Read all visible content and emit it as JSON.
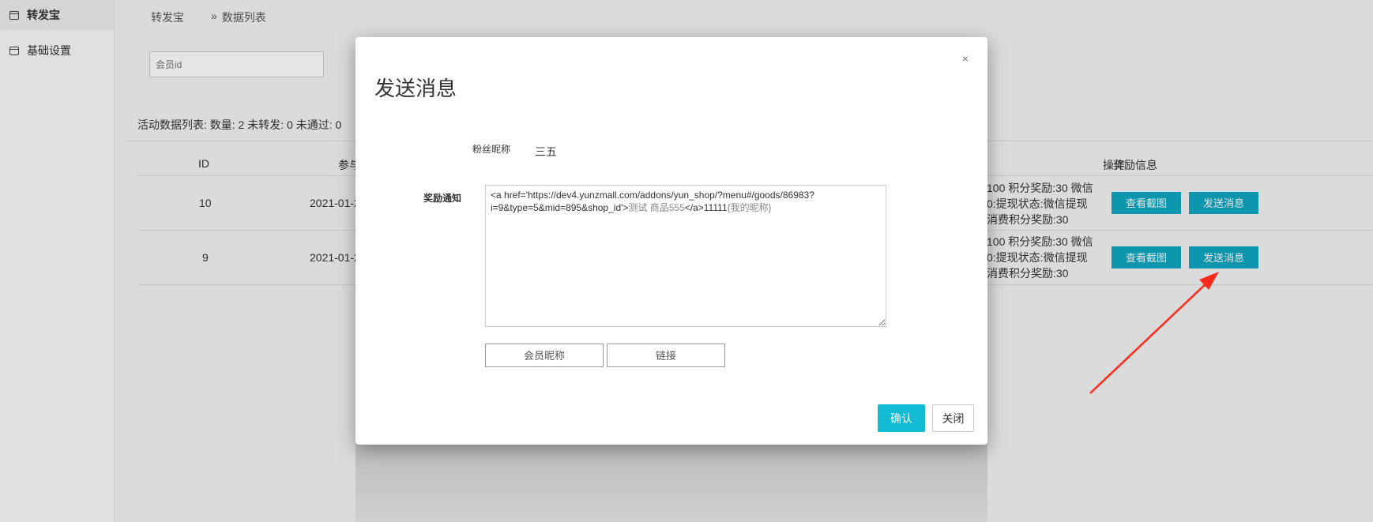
{
  "sidebar": {
    "items": [
      {
        "label": "转发宝",
        "icon": "window-icon",
        "active": true
      },
      {
        "label": "基础设置",
        "icon": "window-icon",
        "active": false
      }
    ]
  },
  "breadcrumb": {
    "root": "转发宝",
    "separator": "»",
    "current": "数据列表"
  },
  "search": {
    "placeholder": "会员id"
  },
  "stats": {
    "text": "活动数据列表: 数量: 2 未转发: 0 未通过: 0"
  },
  "table": {
    "headers": [
      "ID",
      "参与",
      "奖励信息",
      "操作"
    ],
    "rows": [
      {
        "id": "10",
        "date": "2021-01-2",
        "reward_lines": [
          "100 积分奖励:30 微信",
          "0:提现状态:微信提现",
          "消费积分奖励:30"
        ],
        "view_label": "查看截图",
        "send_label": "发送消息"
      },
      {
        "id": "9",
        "date": "2021-01-2",
        "reward_lines": [
          "100 积分奖励:30 微信",
          "0:提现状态:微信提现",
          "消费积分奖励:30"
        ],
        "view_label": "查看截图",
        "send_label": "发送消息"
      }
    ]
  },
  "modal": {
    "title": "发送消息",
    "close_glyph": "×",
    "nickname_label": "粉丝昵称",
    "nickname_value": "三五",
    "notice_label": "奖励通知",
    "notice_text_dark": "<a href='https://dev4.yunzmall.com/addons/yun_shop/?menu#/goods/86983?i=9&type=5&mid=895&shop_id'>",
    "notice_text_gray": "测试 商品555",
    "notice_text_dark2": "</a>11111",
    "notice_text_gray2": "{我的昵称}",
    "insert_nickname_label": "会员昵称",
    "insert_link_label": "链接",
    "confirm_label": "确认",
    "cancel_label": "关闭"
  },
  "colors": {
    "accent": "#10a7c2",
    "confirm": "#10bbd3",
    "arrow": "#ff2a1a"
  }
}
